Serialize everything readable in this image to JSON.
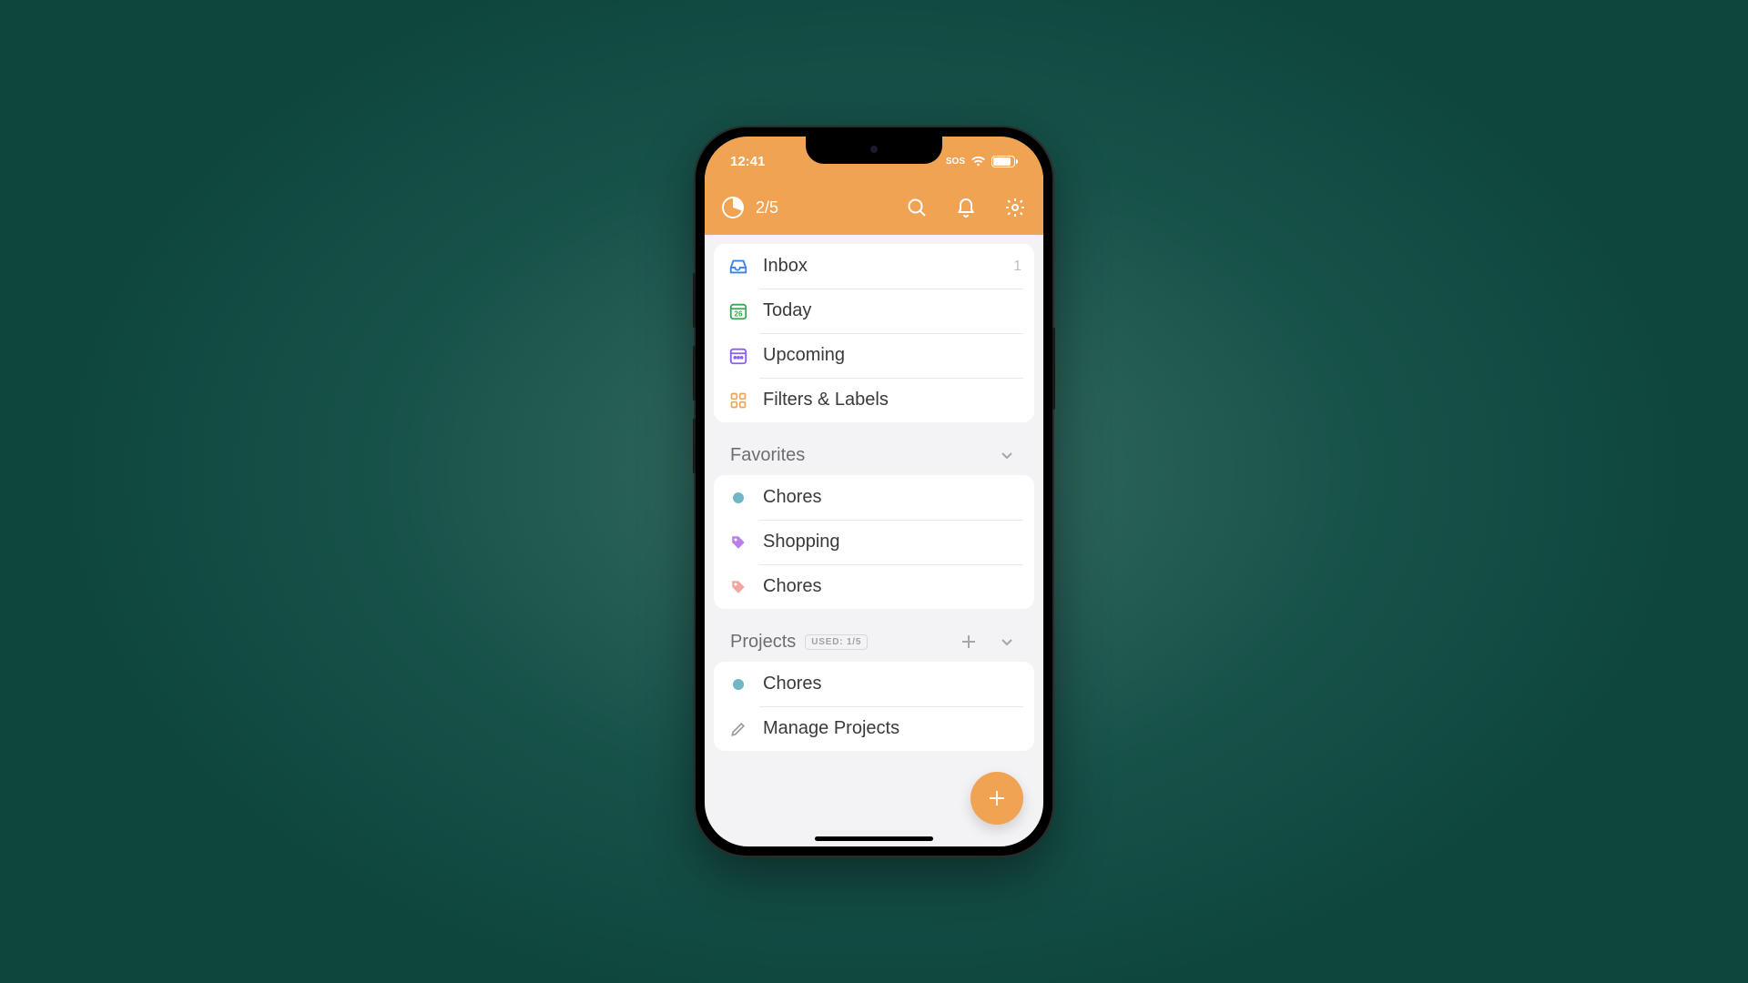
{
  "statusbar": {
    "time": "12:41",
    "sos": "SOS",
    "battery": "87"
  },
  "header": {
    "count": "2/5"
  },
  "nav": {
    "inbox": {
      "label": "Inbox",
      "count": "1"
    },
    "today": {
      "label": "Today",
      "date": "26"
    },
    "upcoming": {
      "label": "Upcoming"
    },
    "filters": {
      "label": "Filters & Labels"
    }
  },
  "favorites": {
    "title": "Favorites",
    "items": [
      "Chores",
      "Shopping",
      "Chores"
    ]
  },
  "projects": {
    "title": "Projects",
    "badge": "USED: 1/5",
    "items": [
      "Chores"
    ],
    "manage": "Manage Projects"
  }
}
